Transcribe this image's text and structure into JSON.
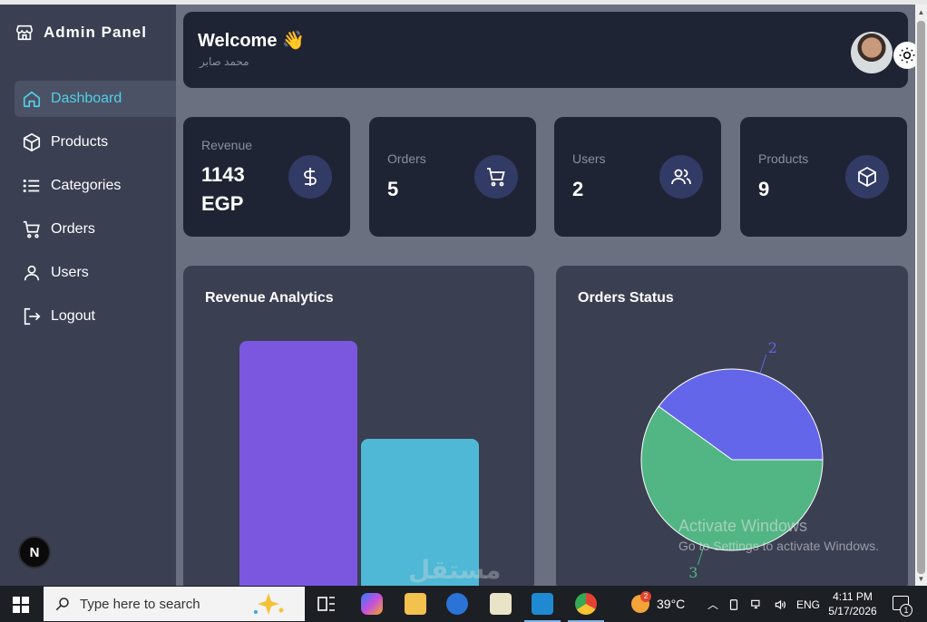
{
  "sidebar": {
    "brand": "Admin Panel",
    "items": [
      {
        "label": "Dashboard",
        "icon": "home-icon",
        "active": true
      },
      {
        "label": "Products",
        "icon": "box-icon"
      },
      {
        "label": "Categories",
        "icon": "list-icon"
      },
      {
        "label": "Orders",
        "icon": "cart-icon"
      },
      {
        "label": "Users",
        "icon": "user-icon"
      },
      {
        "label": "Logout",
        "icon": "logout-icon"
      }
    ],
    "badge": "N"
  },
  "header": {
    "welcome": "Welcome 👋",
    "subtitle": "محمد صابر"
  },
  "stats": [
    {
      "label": "Revenue",
      "value_line1": "1143",
      "value_line2": "EGP",
      "icon": "dollar-icon"
    },
    {
      "label": "Orders",
      "value_line1": "5",
      "icon": "cart-icon"
    },
    {
      "label": "Users",
      "value_line1": "2",
      "icon": "users-icon"
    },
    {
      "label": "Products",
      "value_line1": "9",
      "icon": "cube-icon"
    }
  ],
  "panels": {
    "revenue_title": "Revenue Analytics",
    "orders_title": "Orders Status"
  },
  "chart_data": [
    {
      "type": "bar",
      "title": "Revenue Analytics",
      "categories": [
        "",
        ""
      ],
      "values": [
        100,
        61
      ],
      "colors": [
        "#7b57e0",
        "#4fb8d6"
      ],
      "ylim": [
        0,
        100
      ]
    },
    {
      "type": "pie",
      "title": "Orders Status",
      "values": [
        2,
        3
      ],
      "labels": [
        "2",
        "3"
      ],
      "colors": [
        "#6366e8",
        "#52b584"
      ]
    }
  ],
  "watermark": {
    "line1": "Activate Windows",
    "line2": "Go to Settings to activate Windows."
  },
  "overlay_text": "مستقل",
  "taskbar": {
    "search_placeholder": "Type here to search",
    "temperature": "39°C",
    "weather_badge": "2",
    "language": "ENG",
    "time": "4:11 PM",
    "date": "5/17/2026",
    "notification_count": "1"
  },
  "colors": {
    "accent": "#4fd1e8",
    "card_bg": "#1f2434",
    "panel_bg": "#3a3f52",
    "icon_circle": "#323a66"
  }
}
